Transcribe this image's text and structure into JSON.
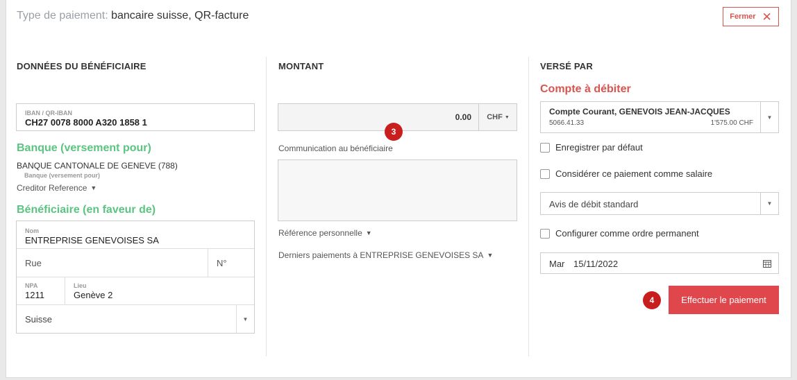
{
  "header": {
    "payment_type_label": "Type de paiement:",
    "payment_type_value": "bancaire suisse, QR-facture",
    "close_label": "Fermer"
  },
  "beneficiary": {
    "title": "DONNÉES DU BÉNÉFICIAIRE",
    "iban_label": "IBAN / QR-IBAN",
    "iban_value": "CH27 0078 8000 A320 1858 1",
    "bank_heading": "Banque (versement pour)",
    "bank_name": "BANQUE CANTONALE DE GENEVE (788)",
    "bank_sublabel": "Banque (versement pour)",
    "creditor_reference": "Creditor Reference",
    "recipient_heading": "Bénéficiaire (en faveur de)",
    "name_label": "Nom",
    "name_value": "ENTREPRISE GENEVOISES SA",
    "street_placeholder": "Rue",
    "number_placeholder": "N°",
    "npa_label": "NPA",
    "npa_value": "1211",
    "city_label": "Lieu",
    "city_value": "Genève 2",
    "country": "Suisse"
  },
  "amount": {
    "title": "MONTANT",
    "value": "0.00",
    "currency": "CHF",
    "communication_label": "Communication au bénéficiaire",
    "personal_reference": "Référence personnelle",
    "last_payments": "Derniers paiements à ENTREPRISE GENEVOISES SA"
  },
  "paid_by": {
    "title": "VERSÉ PAR",
    "debit_heading": "Compte à débiter",
    "account_name": "Compte Courant, GENEVOIS JEAN-JACQUES",
    "account_number": "5066.41.33",
    "account_balance": "1'575.00 CHF",
    "save_default": "Enregistrer par défaut",
    "as_salary": "Considérer ce paiement comme salaire",
    "debit_notice": "Avis de débit standard",
    "standing_order": "Configurer comme ordre permanent",
    "date_day": "Mar",
    "date_value": "15/11/2022",
    "pay_button": "Effectuer le paiement"
  },
  "badges": {
    "step3": "3",
    "step4": "4"
  },
  "colors": {
    "accent_red": "#e0474c",
    "heading_green": "#5bc481",
    "heading_red": "#d9534f",
    "badge": "#c81e1e"
  }
}
